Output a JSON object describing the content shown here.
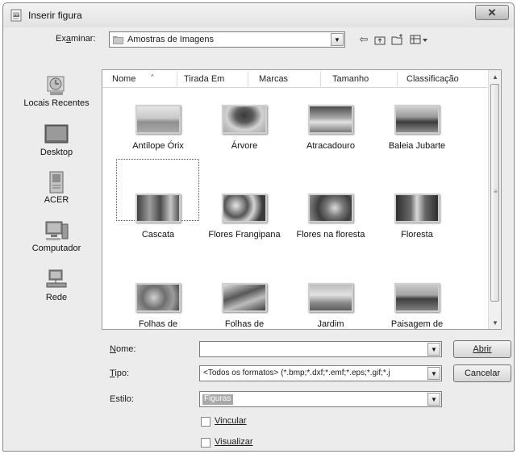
{
  "window": {
    "title": "Inserir figura",
    "close_glyph": "✕"
  },
  "lookin": {
    "label": "Examinar:",
    "value": "Amostras de Imagens"
  },
  "toolbar": [
    "back-icon",
    "up-folder-icon",
    "new-folder-icon",
    "views-menu-icon"
  ],
  "places": [
    {
      "label": "Locais Recentes",
      "icon": "recent-places-icon"
    },
    {
      "label": "Desktop",
      "icon": "desktop-icon"
    },
    {
      "label": "ACER",
      "icon": "user-folder-icon"
    },
    {
      "label": "Computador",
      "icon": "computer-icon"
    },
    {
      "label": "Rede",
      "icon": "network-icon"
    }
  ],
  "columns": [
    "Nome",
    "Tirada Em",
    "Marcas",
    "Tamanho",
    "Classificação"
  ],
  "files": [
    {
      "name": "Antílope Órix",
      "selected": true
    },
    {
      "name": "Árvore"
    },
    {
      "name": "Atracadouro"
    },
    {
      "name": "Baleia Jubarte"
    },
    {
      "name": "Cascata"
    },
    {
      "name": "Flores Frangipana"
    },
    {
      "name": "Flores na floresta"
    },
    {
      "name": "Floresta"
    },
    {
      "name": "Folhas de"
    },
    {
      "name": "Folhas de"
    },
    {
      "name": "Jardim"
    },
    {
      "name": "Paisagem de"
    }
  ],
  "form": {
    "name_label": "Nome:",
    "name_value": "",
    "type_label": "Tipo:",
    "type_value": "<Todos os formatos> (*.bmp;*.dxf;*.emf;*.eps;*.gif;*.j",
    "style_label": "Estilo:",
    "style_value": "Figuras",
    "open_button": "Abrir",
    "cancel_button": "Cancelar",
    "link_label": "Vincular",
    "preview_label": "Visualizar"
  }
}
